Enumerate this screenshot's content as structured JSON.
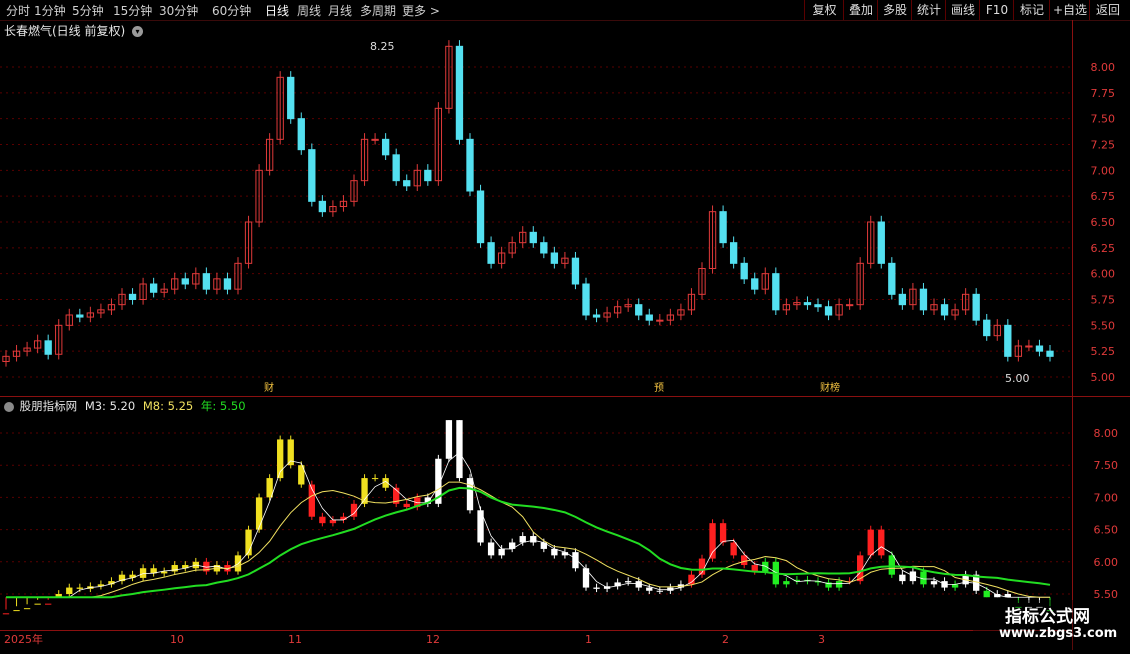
{
  "toolbar": {
    "periods": [
      "分时",
      "1分钟",
      "5分钟",
      "15分钟",
      "30分钟",
      "60分钟",
      "日线",
      "周线",
      "月线",
      "多周期",
      "更多 >"
    ],
    "active_period": "日线",
    "right_buttons": [
      "复权",
      "叠加",
      "多股",
      "统计",
      "画线",
      "F10",
      "标记",
      "+自选",
      "返回"
    ]
  },
  "main_chart": {
    "title": "长春燃气(日线 前复权)",
    "y_ticks": [
      "8.00",
      "7.75",
      "7.50",
      "7.25",
      "7.00",
      "6.75",
      "6.50",
      "6.25",
      "6.00",
      "5.75",
      "5.50",
      "5.25",
      "5.00"
    ],
    "high_label": "8.25",
    "low_label": "5.00",
    "event_markers": [
      "财",
      "预",
      "财榜"
    ]
  },
  "indicator": {
    "title": "股朋指标网",
    "m3_label": "M3: 5.20",
    "m8_label": "M8: 5.25",
    "year_label": "年: 5.50",
    "y_ticks": [
      "8.00",
      "7.50",
      "7.00",
      "6.50",
      "6.00",
      "5.50"
    ]
  },
  "x_axis": [
    "2025年",
    "10",
    "11",
    "12",
    "1",
    "2",
    "3"
  ],
  "watermark": {
    "title": "指标公式网",
    "url": "www.zbgs3.com"
  },
  "colors": {
    "up": "#e03a3a",
    "down": "#54e0f0",
    "background": "#000000",
    "year_line": "#22dd22",
    "m_line": "#f0e060"
  },
  "chart_data": {
    "type": "candlestick",
    "ylim": [
      4.95,
      8.3
    ],
    "series": [
      {
        "name": "price",
        "values": [
          5.2,
          5.25,
          5.28,
          5.35,
          5.22,
          5.5,
          5.6,
          5.58,
          5.62,
          5.65,
          5.7,
          5.8,
          5.75,
          5.9,
          5.82,
          5.85,
          5.95,
          5.9,
          6.0,
          5.85,
          5.95,
          5.85,
          6.1,
          6.5,
          7.0,
          7.3,
          7.9,
          7.5,
          7.2,
          6.7,
          6.6,
          6.65,
          6.7,
          6.9,
          7.3,
          7.3,
          7.15,
          6.9,
          6.85,
          7.0,
          6.9,
          7.6,
          8.2,
          7.3,
          6.8,
          6.3,
          6.1,
          6.2,
          6.3,
          6.4,
          6.3,
          6.2,
          6.1,
          6.15,
          5.9,
          5.6,
          5.58,
          5.62,
          5.68,
          5.7,
          5.6,
          5.55,
          5.55,
          5.6,
          5.65,
          5.8,
          6.05,
          6.6,
          6.3,
          6.1,
          5.95,
          5.85,
          6.0,
          5.65,
          5.7,
          5.72,
          5.7,
          5.68,
          5.6,
          5.7,
          5.7,
          6.1,
          6.5,
          6.1,
          5.8,
          5.7,
          5.85,
          5.65,
          5.7,
          5.6,
          5.65,
          5.8,
          5.55,
          5.4,
          5.5,
          5.2,
          5.3,
          5.3,
          5.25,
          5.2
        ]
      }
    ]
  }
}
